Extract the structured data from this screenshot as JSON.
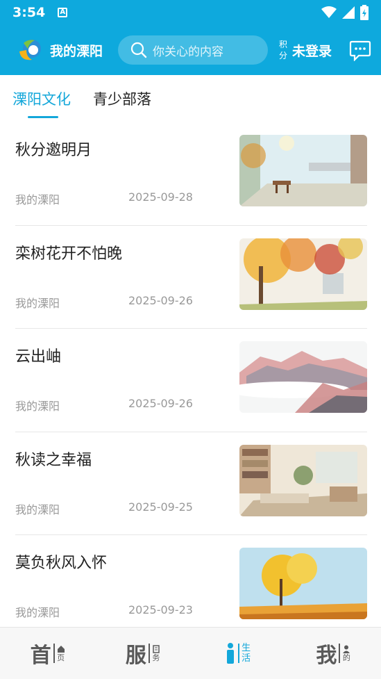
{
  "status_bar": {
    "time": "3:54",
    "notification_icon": "A"
  },
  "header": {
    "app_title": "我的溧阳",
    "search_placeholder": "你关心的内容",
    "points_label_top": "积",
    "points_label_bottom": "分",
    "login_text": "未登录"
  },
  "tabs": [
    {
      "label": "溧阳文化",
      "active": true
    },
    {
      "label": "青少部落",
      "active": false
    }
  ],
  "articles": [
    {
      "title": "秋分邀明月",
      "source": "我的溧阳",
      "date": "2025-09-28",
      "thumb": "courtyard-moon"
    },
    {
      "title": "栾树花开不怕晚",
      "source": "我的溧阳",
      "date": "2025-09-26",
      "thumb": "autumn-tree"
    },
    {
      "title": "云出岫",
      "source": "我的溧阳",
      "date": "2025-09-26",
      "thumb": "mountains-clouds"
    },
    {
      "title": "秋读之幸福",
      "source": "我的溧阳",
      "date": "2025-09-25",
      "thumb": "reading-room"
    },
    {
      "title": "莫负秋风入怀",
      "source": "我的溧阳",
      "date": "2025-09-23",
      "thumb": "golden-tree"
    }
  ],
  "bottom_nav": [
    {
      "big": "首",
      "small_icon": "house-icon",
      "small": "页",
      "active": false
    },
    {
      "big": "服",
      "small_icon": "doc-icon",
      "small": "务",
      "active": false
    },
    {
      "big": "i",
      "small_icon": "",
      "small": "生活",
      "active": true
    },
    {
      "big": "我",
      "small_icon": "person-icon",
      "small": "的",
      "active": false
    }
  ],
  "colors": {
    "brand": "#0ea9dd",
    "active_tab": "#13a7da",
    "meta_text": "#999999"
  }
}
